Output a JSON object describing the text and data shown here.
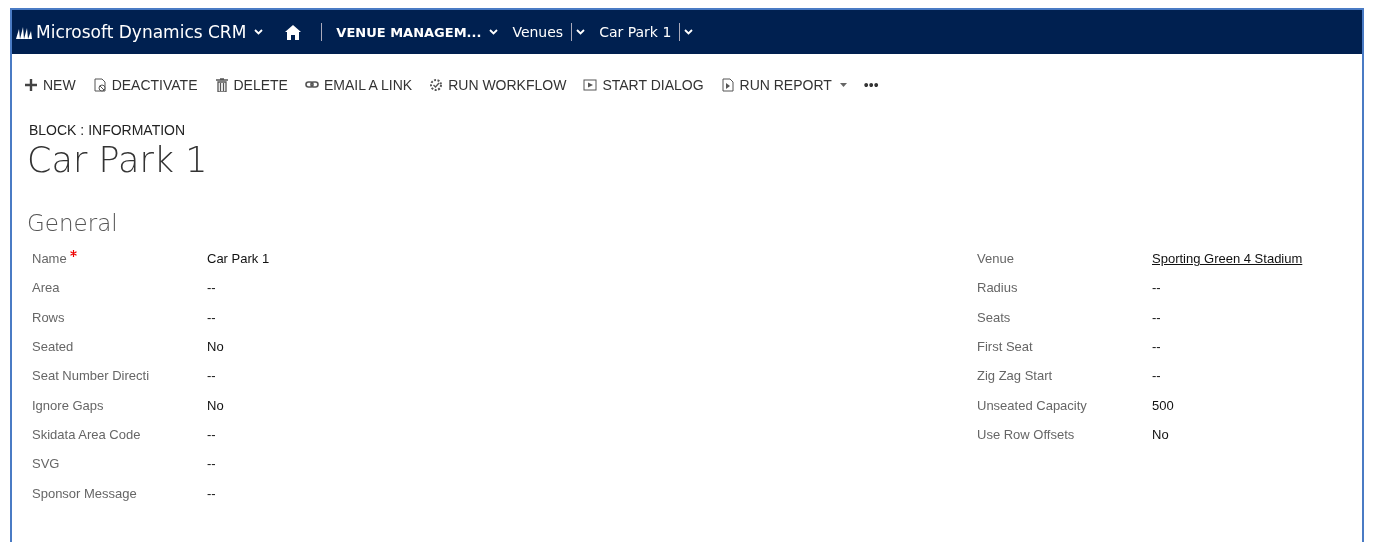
{
  "nav": {
    "app": "Microsoft Dynamics CRM",
    "crumbs": [
      {
        "label": "VENUE MANAGEM...",
        "bold": true,
        "separator": false
      },
      {
        "label": "Venues",
        "bold": false,
        "separator": true
      },
      {
        "label": "Car Park 1",
        "bold": false,
        "separator": true
      }
    ]
  },
  "toolbar": [
    {
      "label": "NEW",
      "dropdown": false
    },
    {
      "label": "DEACTIVATE",
      "dropdown": false
    },
    {
      "label": "DELETE",
      "dropdown": false
    },
    {
      "label": "EMAIL A LINK",
      "dropdown": false
    },
    {
      "label": "RUN WORKFLOW",
      "dropdown": false
    },
    {
      "label": "START DIALOG",
      "dropdown": false
    },
    {
      "label": "RUN REPORT",
      "dropdown": true
    },
    {
      "label": "•••",
      "dropdown": false
    }
  ],
  "form_type": "BLOCK : INFORMATION",
  "record_title": "Car Park 1",
  "section_title": "General",
  "left_fields": [
    {
      "label": "Name",
      "required": true,
      "value": "Car Park 1",
      "kind": "text"
    },
    {
      "label": "Area",
      "required": false,
      "value": "--",
      "kind": "text"
    },
    {
      "label": "Rows",
      "required": false,
      "value": "--",
      "kind": "text"
    },
    {
      "label": "Seated",
      "required": false,
      "value": "No",
      "kind": "text"
    },
    {
      "label": "Seat Number Directi",
      "required": false,
      "value": "--",
      "kind": "text"
    },
    {
      "label": "Ignore Gaps",
      "required": false,
      "value": "No",
      "kind": "text"
    },
    {
      "label": "Skidata Area Code",
      "required": false,
      "value": "--",
      "kind": "text"
    },
    {
      "label": "SVG",
      "required": false,
      "value": "--",
      "kind": "text"
    },
    {
      "label": "Sponsor Message",
      "required": false,
      "value": "--",
      "kind": "text"
    }
  ],
  "right_fields": [
    {
      "label": "Venue",
      "required": false,
      "value": "Sporting Green 4 Stadium",
      "kind": "link"
    },
    {
      "label": "Radius",
      "required": false,
      "value": "--",
      "kind": "text"
    },
    {
      "label": "Seats",
      "required": false,
      "value": "--",
      "kind": "text"
    },
    {
      "label": "First Seat",
      "required": false,
      "value": "--",
      "kind": "text"
    },
    {
      "label": "Zig Zag Start",
      "required": false,
      "value": "--",
      "kind": "text"
    },
    {
      "label": "Unseated Capacity",
      "required": false,
      "value": "500",
      "kind": "text"
    },
    {
      "label": "Use Row Offsets",
      "required": false,
      "value": "No",
      "kind": "text"
    }
  ]
}
